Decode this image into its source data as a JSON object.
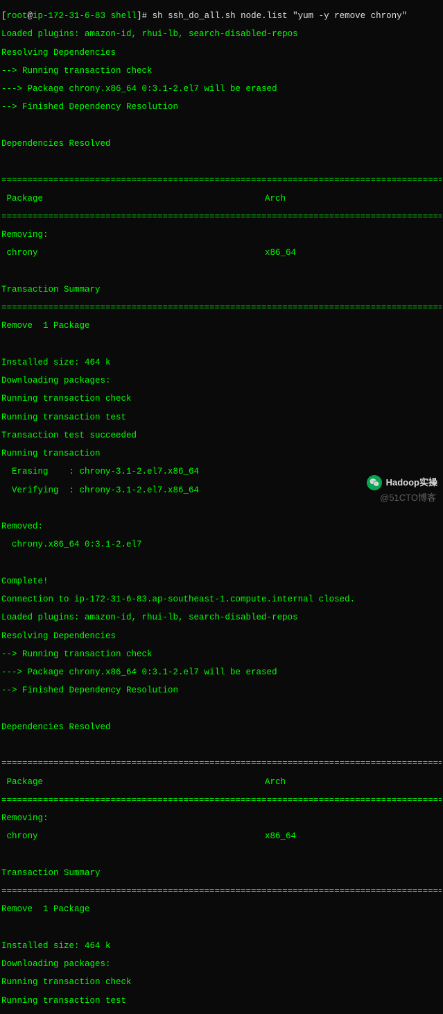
{
  "prompt": {
    "user": "root",
    "host": "ip-172-31-6-83",
    "cwd": "shell",
    "command": "sh ssh_do_all.sh node.list \"yum -y remove chrony\""
  },
  "block1": {
    "loaded_plugins": "Loaded plugins: amazon-id, rhui-lb, search-disabled-repos",
    "resolving": "Resolving Dependencies",
    "check": "--> Running transaction check",
    "erased": "---> Package chrony.x86_64 0:3.1-2.el7 will be erased",
    "finished": "--> Finished Dependency Resolution",
    "resolved": "Dependencies Resolved",
    "header_package": " Package",
    "header_arch": "Arch",
    "removing_label": "Removing:",
    "pkg_name": " chrony",
    "pkg_arch": "x86_64",
    "summary": "Transaction Summary",
    "remove_count": "Remove  1 Package",
    "installed_size": "Installed size: 464 k",
    "downloading": "Downloading packages:",
    "tcheck": "Running transaction check",
    "ttest": "Running transaction test",
    "tsucceed": "Transaction test succeeded",
    "running": "Running transaction",
    "erasing": "  Erasing    : chrony-3.1-2.el7.x86_64",
    "verifying": "  Verifying  : chrony-3.1-2.el7.x86_64",
    "removed_label": "Removed:",
    "removed_pkg": "  chrony.x86_64 0:3.1-2.el7",
    "complete": "Complete!",
    "connection_closed": "Connection to ip-172-31-6-83.ap-southeast-1.compute.internal closed."
  },
  "block2": {
    "loaded_plugins": "Loaded plugins: amazon-id, rhui-lb, search-disabled-repos",
    "resolving": "Resolving Dependencies",
    "check": "--> Running transaction check",
    "erased": "---> Package chrony.x86_64 0:3.1-2.el7 will be erased",
    "finished": "--> Finished Dependency Resolution",
    "resolved": "Dependencies Resolved",
    "header_package": " Package",
    "header_arch": "Arch",
    "removing_label": "Removing:",
    "pkg_name": " chrony",
    "pkg_arch": "x86_64",
    "summary": "Transaction Summary",
    "remove_count": "Remove  1 Package",
    "installed_size": "Installed size: 464 k",
    "downloading": "Downloading packages:",
    "tcheck": "Running transaction check",
    "ttest": "Running transaction test"
  },
  "divider": "================================================================================================",
  "watermarks": {
    "wechat_text": "Hadoop实操",
    "blog_text": "@51CTO博客"
  }
}
